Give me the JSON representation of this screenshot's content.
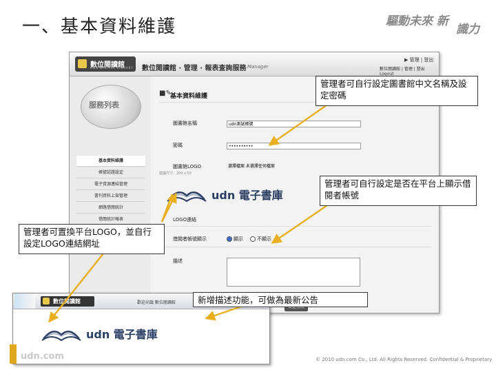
{
  "slide": {
    "title": "一、基本資料維護",
    "slogan_line1": "驅動未來 新",
    "slogan_line2": "識力"
  },
  "screenshot": {
    "logo_text": "數位閱讀館",
    "logo_sub": "UDN DIGITAL LIBRARY",
    "system_title": "數位閱讀館 · 管理 · 報表查詢服務",
    "manager_label": "Manager",
    "top_right_line1": "▶ 管理 | 登出",
    "top_right_line2": "數位閱讀館 | 管理 | 登出 Logout",
    "sidebar": {
      "ball_label": "服務列表",
      "items": [
        {
          "label": "基本資料維護",
          "active": true
        },
        {
          "label": "帳號認證設定",
          "active": false
        },
        {
          "label": "電子資源連結管理",
          "active": false
        },
        {
          "label": "書刊資料上架管理",
          "active": false
        },
        {
          "label": "網路借閱統計",
          "active": false
        },
        {
          "label": "借閱統計報表",
          "active": false
        },
        {
          "label": "讀者使用紀錄",
          "active": false
        },
        {
          "label": "好的閱讀統計報表",
          "active": false
        }
      ]
    },
    "form": {
      "heading": "基本資料維護",
      "fields": [
        {
          "label": "圖書館名稱",
          "value": "udn測試帳號"
        },
        {
          "label": "密碼",
          "value": "••••••••••"
        },
        {
          "label": "圖書館LOGO",
          "value": "選擇檔案  未選擇任何檔案"
        },
        {
          "label": "LOGO連結",
          "value": ""
        }
      ],
      "logo_hint": "建議尺寸：200 x 50",
      "show_account_label": "借閱者帳號顯示",
      "radio_show": "顯示",
      "radio_hide": "不顯示",
      "description_label": "描述",
      "submit_label": "確定修改"
    },
    "udn_logo_text": "udn 電子書庫"
  },
  "mini": {
    "logo_text": "數位閱讀館",
    "tagline": "歡迎光臨 數位閱讀館",
    "udn_logo_text": "udn 電子書庫"
  },
  "callouts": {
    "name_password": "管理者可自行設定圖書館中文名稱及設定密碼",
    "show_account": "管理者可自行設定是否在平台上顯示借閱者帳號",
    "logo": "管理者可置換平台LOGO，並自行設定LOGO連結網址",
    "description": "新增描述功能，可做為最新公告"
  },
  "footer": {
    "copyright": "© 2010 udn.com Co., Ltd. All Rights Reserved. Confidential & Proprietary",
    "corner": "udn.com"
  },
  "colors": {
    "arrow": "#e8b020",
    "callout_border": "#333333",
    "udn_blue": "#2b3e63"
  }
}
